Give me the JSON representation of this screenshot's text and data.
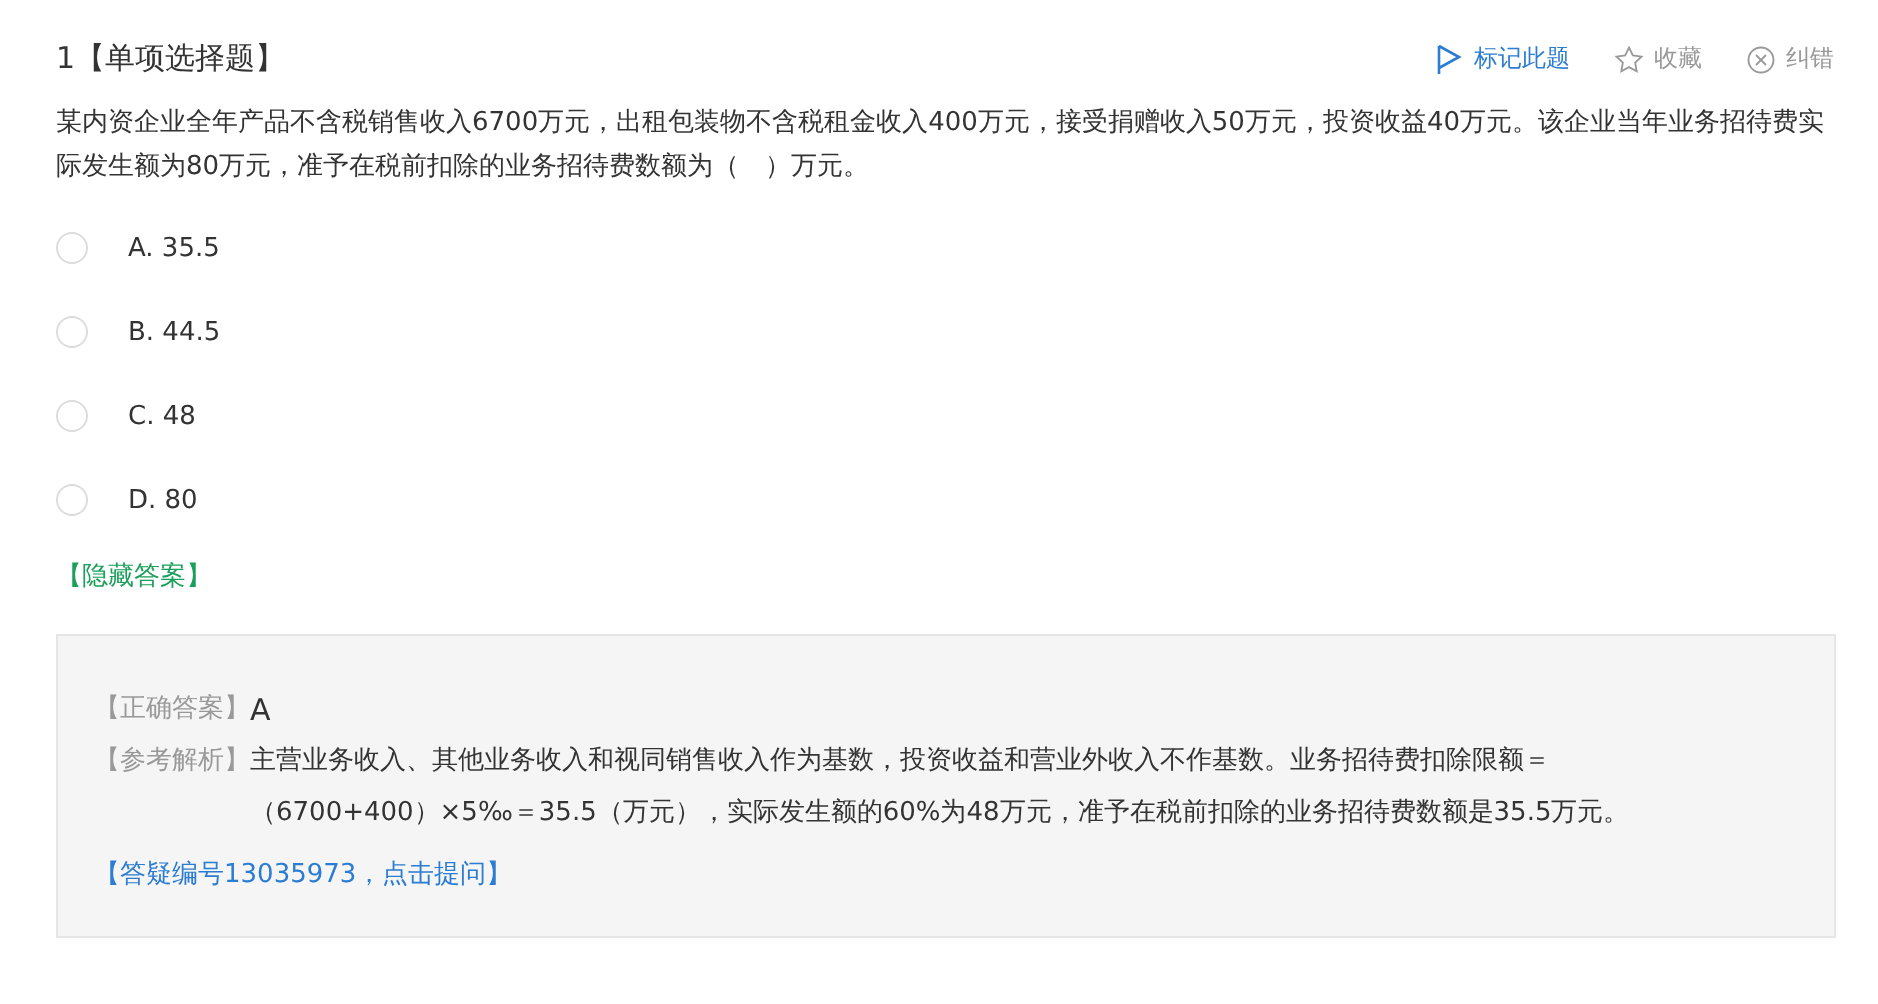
{
  "question": {
    "number": "1",
    "type": "【单项选择题】",
    "text": "某内资企业全年产品不含税销售收入6700万元，出租包装物不含税租金收入400万元，接受捐赠收入50万元，投资收益40万元。该企业当年业务招待费实际发生额为80万元，准予在税前扣除的业务招待费数额为（　）万元。"
  },
  "actions": [
    {
      "kind": "flag",
      "label": "标记此题"
    },
    {
      "kind": "star",
      "label": "收藏"
    },
    {
      "kind": "error",
      "label": "纠错"
    }
  ],
  "options": [
    {
      "letter": "A.",
      "text": "35.5",
      "selected": false
    },
    {
      "letter": "B.",
      "text": "44.5",
      "selected": false
    },
    {
      "letter": "C.",
      "text": "48",
      "selected": false
    },
    {
      "letter": "D.",
      "text": "80",
      "selected": false
    }
  ],
  "toggle_answer": "【隐藏答案】",
  "answer": {
    "label": "【正确答案】",
    "value": "A",
    "analysis_label": "【参考解析】",
    "analysis": "主营业务收入、其他业务收入和视同销售收入作为基数，投资收益和营业外收入不作基数。业务招待费扣除限额＝（6700+400）×5‰＝35.5（万元），实际发生额的60%为48万元，准予在税前扣除的业务招待费数额是35.5万元。",
    "ask_link": "【答疑编号13035973，点击提问】"
  }
}
